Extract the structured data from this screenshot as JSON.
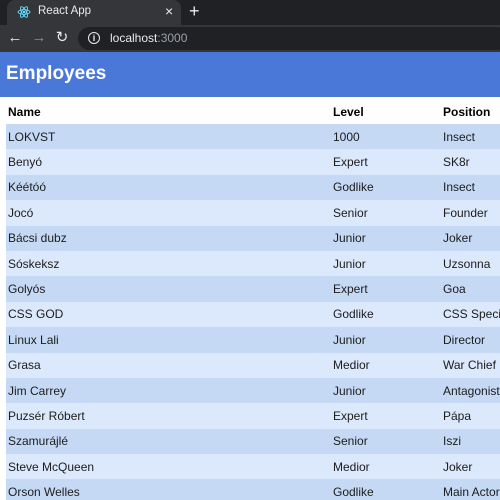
{
  "browser": {
    "tab_title": "React App",
    "tab_close": "×",
    "new_tab": "+",
    "url_host": "localhost",
    "url_port": ":3000"
  },
  "page": {
    "title": "Employees",
    "header_color": "#4a78d8"
  },
  "table": {
    "columns": [
      "Name",
      "Level",
      "Position"
    ],
    "rows": [
      [
        "LOKVST",
        "1000",
        "Insect"
      ],
      [
        "Benyó",
        "Expert",
        "SK8r"
      ],
      [
        "Kéétóó",
        "Godlike",
        "Insect"
      ],
      [
        "Jocó",
        "Senior",
        "Founder"
      ],
      [
        "Bácsi dubz",
        "Junior",
        "Joker"
      ],
      [
        "Sóskeksz",
        "Junior",
        "Uzsonna"
      ],
      [
        "Golyós",
        "Expert",
        "Goa"
      ],
      [
        "CSS GOD",
        "Godlike",
        "CSS Specialist"
      ],
      [
        "Linux Lali",
        "Junior",
        "Director"
      ],
      [
        "Grasa",
        "Medior",
        "War Chief"
      ],
      [
        "Jim Carrey",
        "Junior",
        "Antagonist"
      ],
      [
        "Puzsér Róbert",
        "Expert",
        "Pápa"
      ],
      [
        "Szamurájlé",
        "Senior",
        "Iszi"
      ],
      [
        "Steve McQueen",
        "Medior",
        "Joker"
      ],
      [
        "Orson Welles",
        "Godlike",
        "Main Actor"
      ]
    ],
    "row_colors": [
      "#c5d9f5",
      "#dce8fb"
    ]
  }
}
